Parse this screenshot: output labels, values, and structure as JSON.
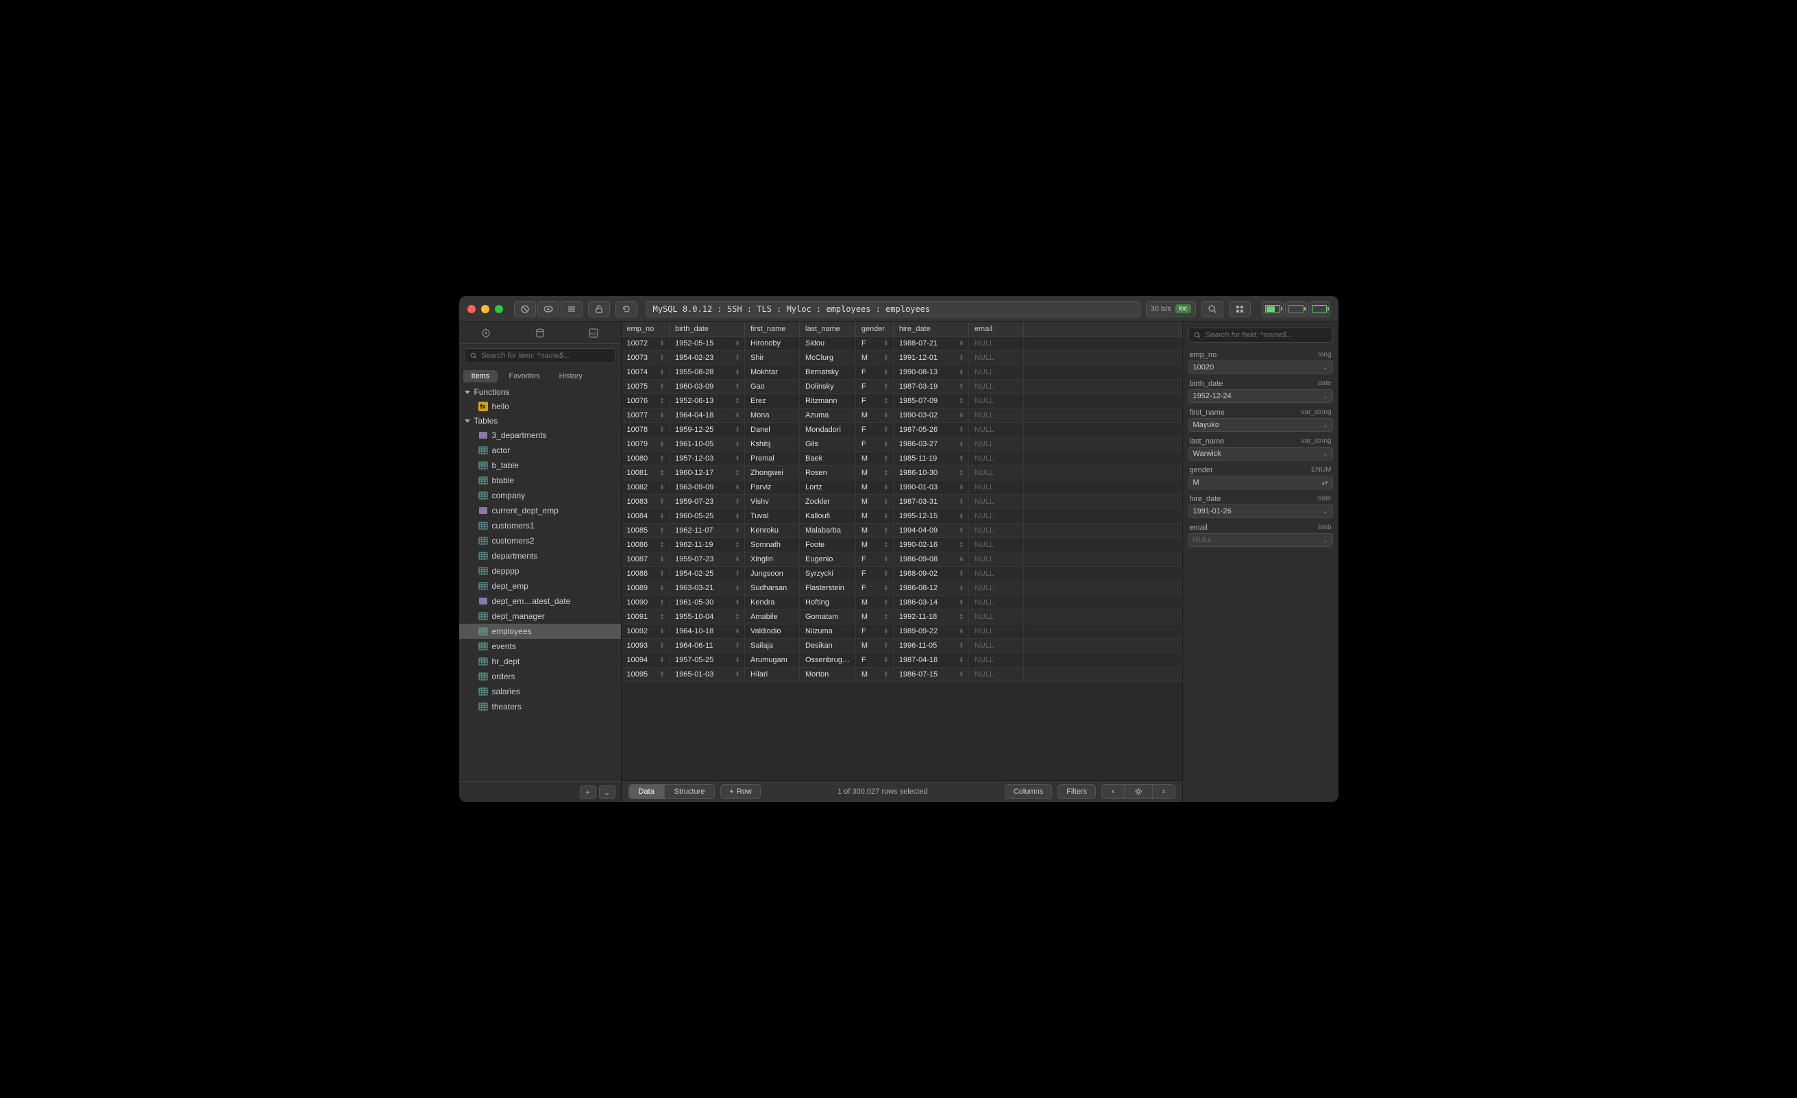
{
  "titlebar": {
    "breadcrumb": "MySQL 8.0.12 : SSH : TLS : Myloc : employees : employees",
    "speed": "30 b/s",
    "loc_badge": "loc"
  },
  "sidebar": {
    "search_placeholder": "Search for item: ^name$...",
    "tabs": [
      "Items",
      "Favorites",
      "History"
    ],
    "sections": {
      "functions": {
        "label": "Functions",
        "items": [
          {
            "name": "hello",
            "icon": "fn"
          }
        ]
      },
      "tables": {
        "label": "Tables",
        "items": [
          {
            "name": "3_departments",
            "icon": "view"
          },
          {
            "name": "actor",
            "icon": "tbl"
          },
          {
            "name": "b_table",
            "icon": "tbl"
          },
          {
            "name": "btable",
            "icon": "tbl"
          },
          {
            "name": "company",
            "icon": "tbl"
          },
          {
            "name": "current_dept_emp",
            "icon": "view"
          },
          {
            "name": "customers1",
            "icon": "tbl"
          },
          {
            "name": "customers2",
            "icon": "tbl"
          },
          {
            "name": "departments",
            "icon": "tbl"
          },
          {
            "name": "depppp",
            "icon": "tbl"
          },
          {
            "name": "dept_emp",
            "icon": "tbl"
          },
          {
            "name": "dept_em…atest_date",
            "icon": "view"
          },
          {
            "name": "dept_manager",
            "icon": "tbl"
          },
          {
            "name": "employees",
            "icon": "tbl",
            "selected": true
          },
          {
            "name": "events",
            "icon": "tbl"
          },
          {
            "name": "hr_dept",
            "icon": "tbl"
          },
          {
            "name": "orders",
            "icon": "tbl"
          },
          {
            "name": "salaries",
            "icon": "tbl"
          },
          {
            "name": "theaters",
            "icon": "tbl"
          }
        ]
      }
    }
  },
  "grid": {
    "columns": [
      "emp_no",
      "birth_date",
      "first_name",
      "last_name",
      "gender",
      "hire_date",
      "email"
    ],
    "rows": [
      [
        "10072",
        "1952-05-15",
        "Hironoby",
        "Sidou",
        "F",
        "1988-07-21",
        "NULL"
      ],
      [
        "10073",
        "1954-02-23",
        "Shir",
        "McClurg",
        "M",
        "1991-12-01",
        "NULL"
      ],
      [
        "10074",
        "1955-08-28",
        "Mokhtar",
        "Bernatsky",
        "F",
        "1990-08-13",
        "NULL"
      ],
      [
        "10075",
        "1960-03-09",
        "Gao",
        "Dolinsky",
        "F",
        "1987-03-19",
        "NULL"
      ],
      [
        "10076",
        "1952-06-13",
        "Erez",
        "Ritzmann",
        "F",
        "1985-07-09",
        "NULL"
      ],
      [
        "10077",
        "1964-04-18",
        "Mona",
        "Azuma",
        "M",
        "1990-03-02",
        "NULL"
      ],
      [
        "10078",
        "1959-12-25",
        "Danel",
        "Mondadori",
        "F",
        "1987-05-26",
        "NULL"
      ],
      [
        "10079",
        "1961-10-05",
        "Kshitij",
        "Gils",
        "F",
        "1986-03-27",
        "NULL"
      ],
      [
        "10080",
        "1957-12-03",
        "Premal",
        "Baek",
        "M",
        "1985-11-19",
        "NULL"
      ],
      [
        "10081",
        "1960-12-17",
        "Zhongwei",
        "Rosen",
        "M",
        "1986-10-30",
        "NULL"
      ],
      [
        "10082",
        "1963-09-09",
        "Parviz",
        "Lortz",
        "M",
        "1990-01-03",
        "NULL"
      ],
      [
        "10083",
        "1959-07-23",
        "Vishv",
        "Zockler",
        "M",
        "1987-03-31",
        "NULL"
      ],
      [
        "10084",
        "1960-05-25",
        "Tuval",
        "Kalloufi",
        "M",
        "1995-12-15",
        "NULL"
      ],
      [
        "10085",
        "1962-11-07",
        "Kenroku",
        "Malabarba",
        "M",
        "1994-04-09",
        "NULL"
      ],
      [
        "10086",
        "1962-11-19",
        "Somnath",
        "Foote",
        "M",
        "1990-02-16",
        "NULL"
      ],
      [
        "10087",
        "1959-07-23",
        "Xinglin",
        "Eugenio",
        "F",
        "1986-09-08",
        "NULL"
      ],
      [
        "10088",
        "1954-02-25",
        "Jungsoon",
        "Syrzycki",
        "F",
        "1988-09-02",
        "NULL"
      ],
      [
        "10089",
        "1963-03-21",
        "Sudharsan",
        "Flasterstein",
        "F",
        "1986-08-12",
        "NULL"
      ],
      [
        "10090",
        "1961-05-30",
        "Kendra",
        "Hofting",
        "M",
        "1986-03-14",
        "NULL"
      ],
      [
        "10091",
        "1955-10-04",
        "Amabile",
        "Gomatam",
        "M",
        "1992-11-18",
        "NULL"
      ],
      [
        "10092",
        "1964-10-18",
        "Valdiodio",
        "Niizuma",
        "F",
        "1989-09-22",
        "NULL"
      ],
      [
        "10093",
        "1964-06-11",
        "Sailaja",
        "Desikan",
        "M",
        "1996-11-05",
        "NULL"
      ],
      [
        "10094",
        "1957-05-25",
        "Arumugam",
        "Ossenbrug…",
        "F",
        "1987-04-18",
        "NULL"
      ],
      [
        "10095",
        "1965-01-03",
        "Hilari",
        "Morton",
        "M",
        "1986-07-15",
        "NULL"
      ]
    ]
  },
  "footer": {
    "data_label": "Data",
    "structure_label": "Structure",
    "row_label": "Row",
    "status": "1 of 300,027 rows selected",
    "columns_label": "Columns",
    "filters_label": "Filters"
  },
  "inspector": {
    "search_placeholder": "Search for field: ^name$...",
    "fields": [
      {
        "name": "emp_no",
        "type": "long",
        "value": "10020"
      },
      {
        "name": "birth_date",
        "type": "date",
        "value": "1952-12-24"
      },
      {
        "name": "first_name",
        "type": "var_string",
        "value": "Mayuko"
      },
      {
        "name": "last_name",
        "type": "var_string",
        "value": "Warwick"
      },
      {
        "name": "gender",
        "type": "ENUM",
        "value": "M",
        "enum": true
      },
      {
        "name": "hire_date",
        "type": "date",
        "value": "1991-01-26"
      },
      {
        "name": "email",
        "type": "blob",
        "value": "NULL",
        "null": true
      }
    ]
  }
}
